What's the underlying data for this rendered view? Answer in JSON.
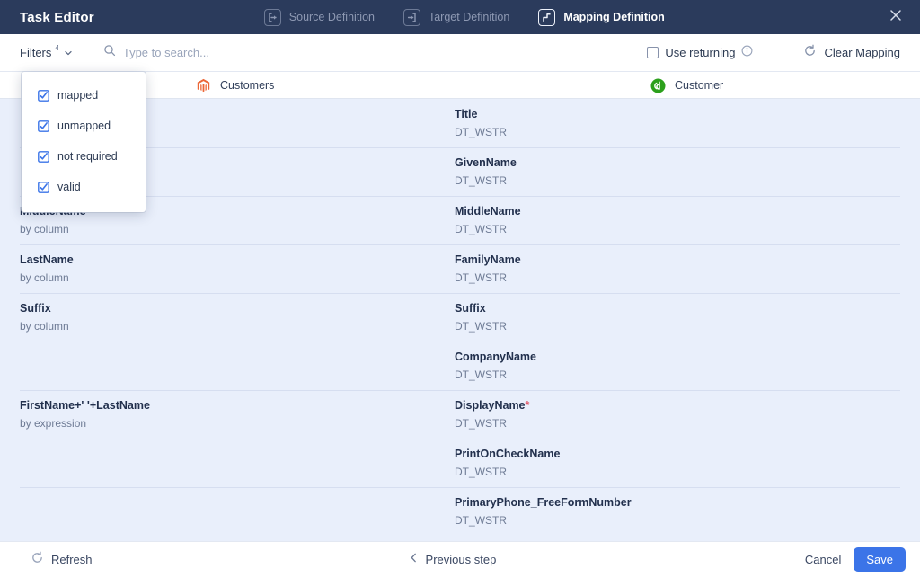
{
  "window": {
    "title": "Task Editor",
    "close_icon": "close-icon"
  },
  "tabs": [
    {
      "label": "Source Definition",
      "icon": "source-definition-icon",
      "active": false
    },
    {
      "label": "Target Definition",
      "icon": "target-definition-icon",
      "active": false
    },
    {
      "label": "Mapping Definition",
      "icon": "mapping-definition-icon",
      "active": true
    }
  ],
  "toolbar": {
    "filters_label": "Filters",
    "filters_count": "4",
    "chevron_icon": "chevron-down-icon",
    "search_icon": "search-icon",
    "search_placeholder": "Type to search...",
    "search_value": "",
    "use_returning_label": "Use returning",
    "use_returning_checked": false,
    "info_icon": "info-icon",
    "clear_mapping_label": "Clear Mapping",
    "clear_mapping_icon": "refresh-ccw-icon"
  },
  "filters_dropdown": {
    "open": true,
    "items": [
      {
        "label": "mapped",
        "checked": true
      },
      {
        "label": "unmapped",
        "checked": true
      },
      {
        "label": "not required",
        "checked": true
      },
      {
        "label": "valid",
        "checked": true
      }
    ]
  },
  "columns": {
    "source": {
      "label": "Customers",
      "icon": "magento-icon"
    },
    "target": {
      "label": "Customer",
      "icon": "quickbooks-icon"
    }
  },
  "rows": [
    {
      "source_name": "",
      "source_sub": "",
      "target_name": "Title",
      "target_required": false,
      "target_type": "DT_WSTR"
    },
    {
      "source_name": "",
      "source_sub": "",
      "target_name": "GivenName",
      "target_required": false,
      "target_type": "DT_WSTR"
    },
    {
      "source_name": "MiddleName",
      "source_sub": "by column",
      "target_name": "MiddleName",
      "target_required": false,
      "target_type": "DT_WSTR"
    },
    {
      "source_name": "LastName",
      "source_sub": "by column",
      "target_name": "FamilyName",
      "target_required": false,
      "target_type": "DT_WSTR"
    },
    {
      "source_name": "Suffix",
      "source_sub": "by column",
      "target_name": "Suffix",
      "target_required": false,
      "target_type": "DT_WSTR"
    },
    {
      "source_name": "",
      "source_sub": "",
      "target_name": "CompanyName",
      "target_required": false,
      "target_type": "DT_WSTR"
    },
    {
      "source_name": "FirstName+' '+LastName",
      "source_sub": "by expression",
      "target_name": "DisplayName",
      "target_required": true,
      "target_type": "DT_WSTR"
    },
    {
      "source_name": "",
      "source_sub": "",
      "target_name": "PrintOnCheckName",
      "target_required": false,
      "target_type": "DT_WSTR"
    },
    {
      "source_name": "",
      "source_sub": "",
      "target_name": "PrimaryPhone_FreeFormNumber",
      "target_required": false,
      "target_type": "DT_WSTR"
    }
  ],
  "footer": {
    "refresh_label": "Refresh",
    "refresh_icon": "refresh-icon",
    "previous_label": "Previous step",
    "previous_icon": "chevron-left-icon",
    "cancel_label": "Cancel",
    "save_label": "Save"
  },
  "colors": {
    "titlebar": "#2b3b5c",
    "accent": "#3b74e8",
    "row_bg": "#e9effb",
    "magento_orange": "#ec6737",
    "quickbooks_green": "#2ca01c",
    "required_red": "#e05a6a"
  }
}
